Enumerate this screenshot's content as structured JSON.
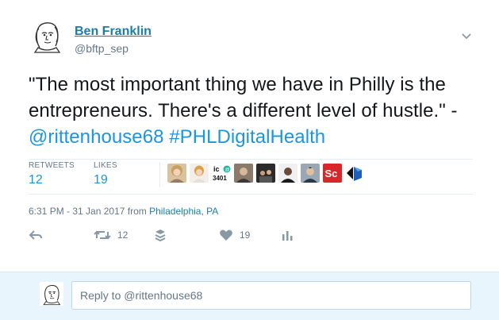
{
  "tweet": {
    "author_name": "Ben Franklin",
    "author_handle": "@bftp_sep",
    "text_quote": "\"The most important thing we have in Philly is the entrepreneurs. There's a different level of hustle.\" -",
    "mention": "@rittenhouse68",
    "hashtag": "#PHLDigitalHealth",
    "retweets_label": "RETWEETS",
    "retweets_count": "12",
    "likes_label": "LIKES",
    "likes_count": "19",
    "timestamp": "6:31 PM - 31 Jan 2017 from ",
    "location": "Philadelphia, PA"
  },
  "likers": [
    {
      "icon": "woman-blonde-avatar"
    },
    {
      "icon": "woman-avatar"
    },
    {
      "icon": "ic-3401-logo",
      "text_top": "ic",
      "text_bottom": "3401"
    },
    {
      "icon": "man-avatar"
    },
    {
      "icon": "group-photo-avatar"
    },
    {
      "icon": "man-dark-avatar"
    },
    {
      "icon": "man-suit-avatar"
    },
    {
      "icon": "sc-logo",
      "text": "Sc"
    },
    {
      "icon": "blue-cube-logo"
    }
  ],
  "actions": {
    "retweet_count": "12",
    "like_count": "19"
  },
  "reply": {
    "placeholder": "Reply to @rittenhouse68"
  },
  "colors": {
    "link": "#1b95e0",
    "name": "#1b7ea7",
    "muted": "#657786",
    "reply_bg": "#e8f5fd"
  }
}
